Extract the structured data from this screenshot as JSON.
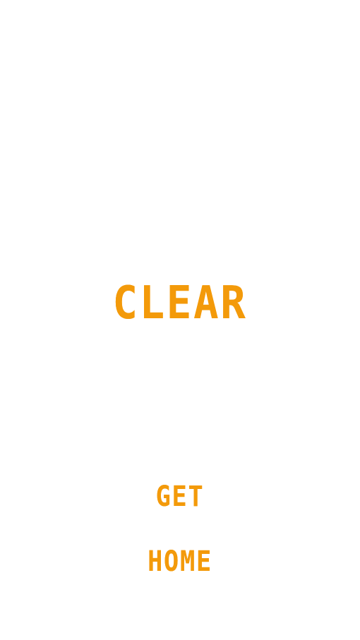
{
  "screen": {
    "title": "CLEAR",
    "buttons": {
      "get_label": "GET",
      "home_label": "HOME"
    }
  },
  "colors": {
    "accent": "#f39a0a",
    "background": "#ffffff"
  }
}
